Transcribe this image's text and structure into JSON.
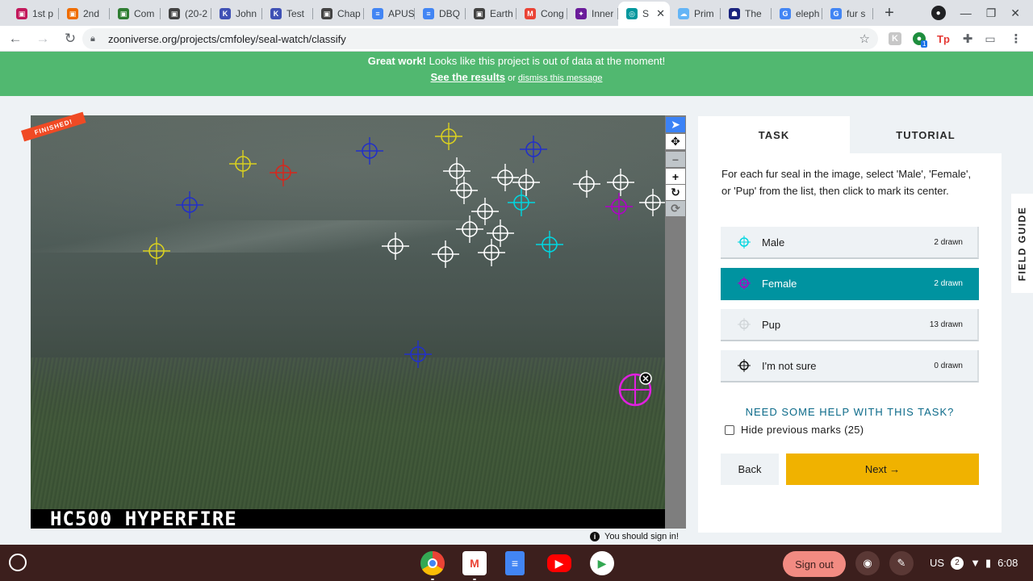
{
  "browser": {
    "tabs": [
      {
        "label": "1st p",
        "icon": "classroom-icon",
        "color": "#c2185b"
      },
      {
        "label": "2nd",
        "icon": "classroom-icon",
        "color": "#ef6c00"
      },
      {
        "label": "Com",
        "icon": "classroom-icon",
        "color": "#2e7d32"
      },
      {
        "label": "(20-2",
        "icon": "classroom-icon",
        "color": "#424242"
      },
      {
        "label": "John",
        "icon": "k-icon",
        "color": "#3f51b5"
      },
      {
        "label": "Test",
        "icon": "k-icon",
        "color": "#3f51b5"
      },
      {
        "label": "Chap",
        "icon": "classroom-icon",
        "color": "#424242"
      },
      {
        "label": "APUS",
        "icon": "docs-icon",
        "color": "#4285f4"
      },
      {
        "label": "DBQ",
        "icon": "docs-icon",
        "color": "#4285f4"
      },
      {
        "label": "Earth",
        "icon": "classroom-icon",
        "color": "#424242"
      },
      {
        "label": "Cong",
        "icon": "gmail-icon",
        "color": "#ea4335"
      },
      {
        "label": "Inner",
        "icon": "zooniverse-alt-icon",
        "color": "#6a1b9a"
      },
      {
        "label": "S",
        "icon": "zooniverse-icon",
        "color": "#00979d"
      },
      {
        "label": "Prim",
        "icon": "cloud-icon",
        "color": "#64b5f6"
      },
      {
        "label": "The",
        "icon": "person-icon",
        "color": "#1a237e"
      },
      {
        "label": "eleph",
        "icon": "google-icon",
        "color": "#4285f4"
      },
      {
        "label": "fur s",
        "icon": "google-icon",
        "color": "#4285f4"
      }
    ],
    "active_tab_index": 12,
    "url": "zooniverse.org/projects/cmfoley/seal-watch/classify",
    "extension_badge": "1"
  },
  "banner": {
    "bold": "Great work!",
    "message": " Looks like this project is out of data at the moment!",
    "results_link": "See the results",
    "or_text": " or ",
    "dismiss_link": "dismiss this message",
    "color": "#51b870"
  },
  "subject": {
    "caption": "HC500 HYPERFIRE",
    "finished_label": "FINISHED!"
  },
  "sign_in_notice": "You should sign in!",
  "panel": {
    "tabs": [
      {
        "label": "TASK",
        "active": true
      },
      {
        "label": "TUTORIAL",
        "active": false
      }
    ],
    "instruction": "For each fur seal in the image, select 'Male', 'Female', or 'Pup' from the list, then click to mark its center.",
    "choices": [
      {
        "label": "Male",
        "count": "2 drawn",
        "color": "#00d6e0",
        "selected": false
      },
      {
        "label": "Female",
        "count": "2 drawn",
        "color": "#b000c8",
        "selected": true
      },
      {
        "label": "Pup",
        "count": "13 drawn",
        "color": "#cfd4d7",
        "selected": false
      },
      {
        "label": "I'm not sure",
        "count": "0 drawn",
        "color": "#111111",
        "selected": false
      }
    ],
    "help": "NEED SOME HELP WITH THIS TASK?",
    "hide_marks": "Hide previous marks (25)",
    "back": "Back",
    "next": "Next →",
    "field_guide": "FIELD GUIDE"
  },
  "shelf": {
    "sign_out": "Sign out",
    "locale": "US",
    "notifications": "2",
    "time": "6:08"
  }
}
